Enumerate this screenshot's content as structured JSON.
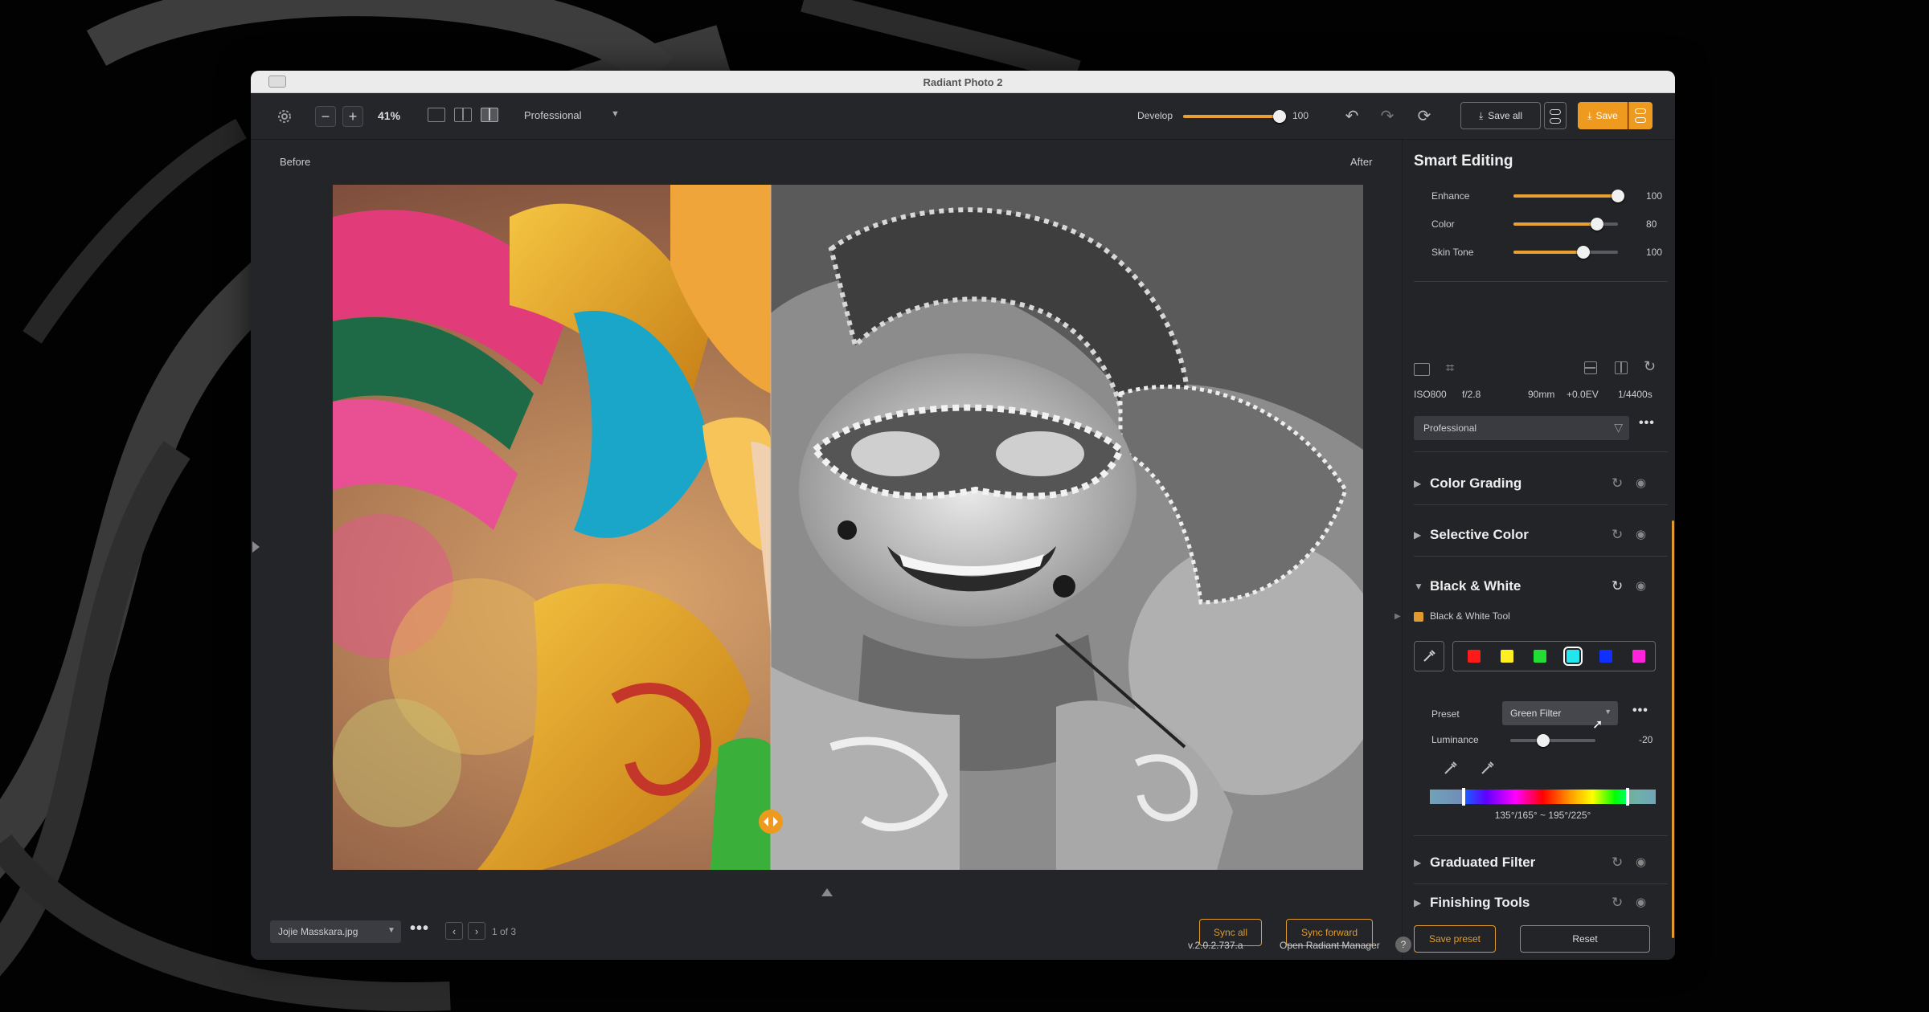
{
  "window": {
    "title": "Radiant Photo 2"
  },
  "toolbar": {
    "zoom": "41%",
    "preset": "Professional",
    "develop_label": "Develop",
    "develop_value": "100",
    "develop_level": 1.0,
    "save_all_label": "Save all",
    "save_label": "Save"
  },
  "canvas": {
    "before_label": "Before",
    "after_label": "After",
    "split_position": 0.425
  },
  "bottom_bar": {
    "file_name": "Jojie Masskara.jpg",
    "page_indicator": "1 of 3",
    "sync_all_label": "Sync all",
    "sync_forward_label": "Sync forward"
  },
  "panel": {
    "title": "Smart Editing",
    "smart_sliders": [
      {
        "label": "Enhance",
        "value": "100",
        "level": 1.0
      },
      {
        "label": "Color",
        "value": "80",
        "level": 0.8
      },
      {
        "label": "Skin Tone",
        "value": "100",
        "level": 0.67
      }
    ],
    "exif": {
      "iso": "ISO800",
      "aperture": "f/2.8",
      "focal": "90mm",
      "ev": "+0.0EV",
      "shutter": "1/4400s"
    },
    "preset_select": "Professional",
    "sections": {
      "color_grading": "Color Grading",
      "selective_color": "Selective Color",
      "black_white": "Black & White",
      "graduated_filter": "Graduated Filter",
      "finishing_tools": "Finishing Tools"
    },
    "bw": {
      "tool_label": "Black & White Tool",
      "swatch_colors": [
        "#ff1a1a",
        "#ffee22",
        "#22dd33",
        "#22e6ee",
        "#1030ff",
        "#ff22dd"
      ],
      "preset_label": "Preset",
      "preset_value": "Green Filter",
      "luminance_label": "Luminance",
      "luminance_value": "-20",
      "luminance_level": 0.39,
      "hue_range": "135°/165° ~ 195°/225°"
    },
    "save_preset_label": "Save preset",
    "reset_label": "Reset",
    "version": "v.2.0.2.737.a",
    "open_manager_label": "Open Radiant Manager",
    "help_label": "?"
  },
  "colors": {
    "accent": "#ee9a1e",
    "panel_bg": "#232428"
  }
}
